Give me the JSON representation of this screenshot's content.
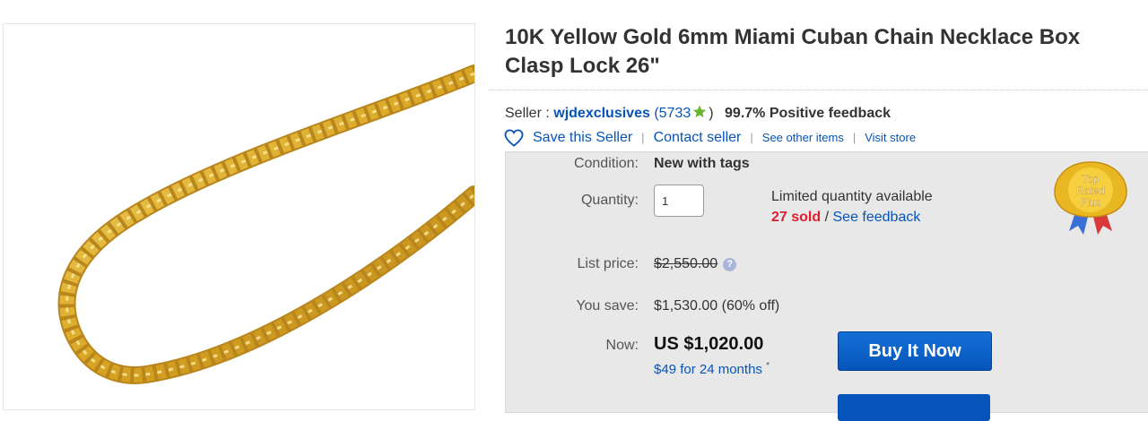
{
  "product": {
    "title": "10K Yellow Gold 6mm Miami Cuban Chain Necklace Box Clasp Lock 26\""
  },
  "seller": {
    "label": "Seller :",
    "name": "wjdexclusives",
    "open_paren": "(",
    "feedback_count": "5733",
    "close_paren": ")",
    "positive": "99.7% Positive feedback",
    "star_color": "#6ab42d"
  },
  "seller_actions": {
    "save": "Save this Seller",
    "contact": "Contact seller",
    "see_items": "See other items",
    "visit": "Visit store",
    "separator": "|"
  },
  "listing": {
    "condition_label": "Condition:",
    "condition_value": "New with tags",
    "quantity_label": "Quantity:",
    "quantity_value": "1",
    "availability": "Limited quantity available",
    "sold": "27 sold",
    "sold_sep": "/",
    "see_feedback": "See feedback",
    "list_price_label": "List price:",
    "list_price": "$2,550.00",
    "info_icon": "?",
    "you_save_label": "You save:",
    "you_save": "$1,530.00 (60% off)",
    "now_label": "Now:",
    "now_price": "US $1,020.00",
    "financing": "$49 for 24 months",
    "financing_mark": "*",
    "buy_button": "Buy It Now"
  },
  "badge": {
    "line1": "Top",
    "line2": "Rated",
    "line3": "Plus"
  },
  "colors": {
    "link": "#0654ba",
    "sold": "#dd1e31",
    "button": "#0654ba",
    "panel": "#e8e8e8",
    "gold": "#e3b52a"
  }
}
